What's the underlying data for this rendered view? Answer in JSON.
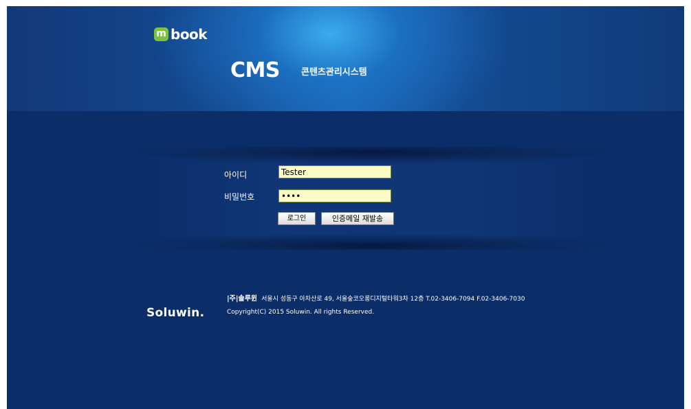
{
  "brand": {
    "logo_mark": "m",
    "logo_text": "book",
    "logo_color": "#7dc23e"
  },
  "header": {
    "title": "CMS",
    "subtitle": "콘텐츠관리시스템"
  },
  "login": {
    "id_label": "아이디",
    "id_value": "Tester",
    "password_label": "비밀번호",
    "password_value": "••••",
    "login_button": "로그인",
    "resend_button": "인증메일 재발송"
  },
  "footer": {
    "logo_text": "Soluwin.",
    "company": "|주|솔루윈",
    "address": "서울시 성동구 아차산로 49, 서울숲코오롱디지털타워3차 12층  T.02-3406-7094  F.02-3406-7030",
    "copyright": "Copyright(C) 2015 Soluwin. All rights Reserved."
  },
  "colors": {
    "background": "#0b2e68",
    "input_background": "#fbfbc8"
  }
}
